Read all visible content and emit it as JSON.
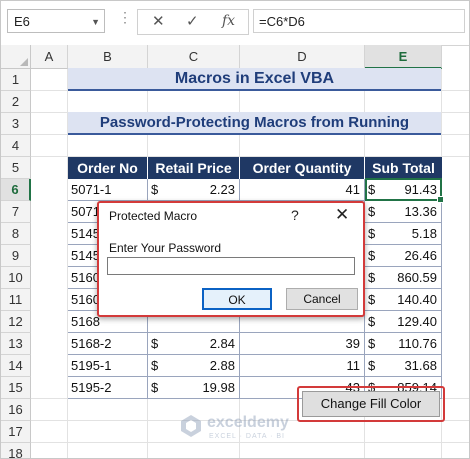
{
  "formula_bar": {
    "name_box": "E6",
    "cancel_icon": "✕",
    "enter_icon": "✓",
    "fx_label": "fx",
    "formula": "=C6*D6"
  },
  "columns": [
    "A",
    "B",
    "C",
    "D",
    "E"
  ],
  "rows": [
    "1",
    "2",
    "3",
    "4",
    "5",
    "6",
    "7",
    "8",
    "9",
    "10",
    "11",
    "12",
    "13",
    "14",
    "15",
    "16",
    "17",
    "18"
  ],
  "title": "Macros in Excel VBA",
  "subtitle": "Password-Protecting Macros from Running",
  "table": {
    "headers": [
      "Order No",
      "Retail Price",
      "Order Quantity",
      "Sub Total"
    ],
    "rows": [
      {
        "order": "5071-1",
        "cur1": "$",
        "price": "2.23",
        "qty": "41",
        "cur2": "$",
        "total": "91.43"
      },
      {
        "order": "5071",
        "cur1": "",
        "price": "",
        "qty": "",
        "cur2": "$",
        "total": "13.36"
      },
      {
        "order": "5145",
        "cur1": "",
        "price": "",
        "qty": "",
        "cur2": "$",
        "total": "5.18"
      },
      {
        "order": "5145",
        "cur1": "",
        "price": "",
        "qty": "",
        "cur2": "$",
        "total": "26.46"
      },
      {
        "order": "5160",
        "cur1": "",
        "price": "",
        "qty": "",
        "cur2": "$",
        "total": "860.59"
      },
      {
        "order": "5160",
        "cur1": "",
        "price": "",
        "qty": "",
        "cur2": "$",
        "total": "140.40"
      },
      {
        "order": "5168",
        "cur1": "",
        "price": "",
        "qty": "",
        "cur2": "$",
        "total": "129.40"
      },
      {
        "order": "5168-2",
        "cur1": "$",
        "price": "2.84",
        "qty": "39",
        "cur2": "$",
        "total": "110.76"
      },
      {
        "order": "5195-1",
        "cur1": "$",
        "price": "2.88",
        "qty": "11",
        "cur2": "$",
        "total": "31.68"
      },
      {
        "order": "5195-2",
        "cur1": "$",
        "price": "19.98",
        "qty": "43",
        "cur2": "$",
        "total": "859.14"
      }
    ]
  },
  "dialog": {
    "title": "Protected Macro",
    "help": "?",
    "close": "✕",
    "prompt": "Enter Your Password",
    "password_value": "",
    "ok_label": "OK",
    "cancel_label": "Cancel"
  },
  "macro_button": {
    "label": "Change Fill Color"
  },
  "watermark": {
    "name": "exceldemy",
    "tagline": "EXCEL · DATA · BI"
  },
  "colors": {
    "header_bg": "#1f3864",
    "banner_bg": "#dde3f2",
    "highlight": "#d33a3a",
    "select": "#217346"
  }
}
